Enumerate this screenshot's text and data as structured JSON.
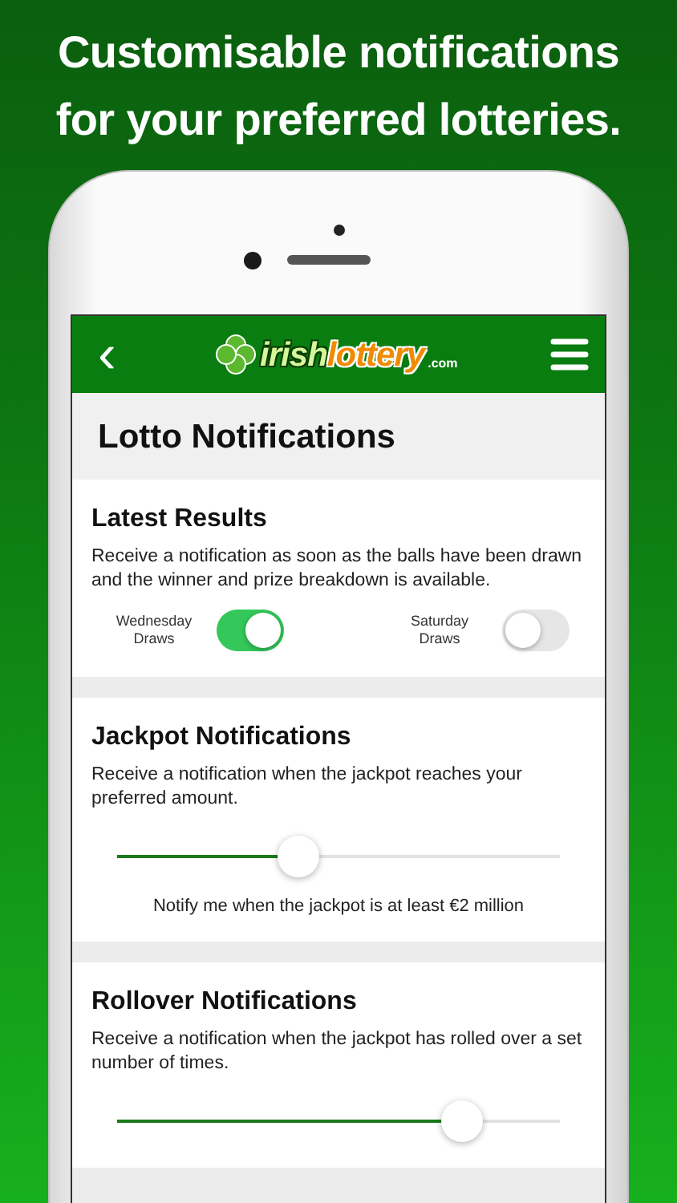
{
  "headline": "Customisable notifications for your preferred lotteries.",
  "nav": {
    "back": "‹",
    "logo": {
      "parts": [
        "irish",
        "lottery"
      ],
      "suffix": ".com"
    }
  },
  "page_title": "Lotto Notifications",
  "sections": [
    {
      "kind": "toggles",
      "title": "Latest Results",
      "description": "Receive a notification as soon as the balls have been drawn and the winner and prize breakdown is available.",
      "toggles": [
        {
          "label": "Wednesday Draws",
          "on": true
        },
        {
          "label": "Saturday Draws",
          "on": false
        }
      ]
    },
    {
      "kind": "slider",
      "title": "Jackpot Notifications",
      "description": "Receive a notification when the jackpot reaches your preferred amount.",
      "level": 0.41,
      "reading": "Notify me when the jackpot is at least €2 million"
    },
    {
      "kind": "slider",
      "title": "Rollover Notifications",
      "description": "Receive a notification when the jackpot has rolled over a set number of times.",
      "level": 0.78
    }
  ]
}
